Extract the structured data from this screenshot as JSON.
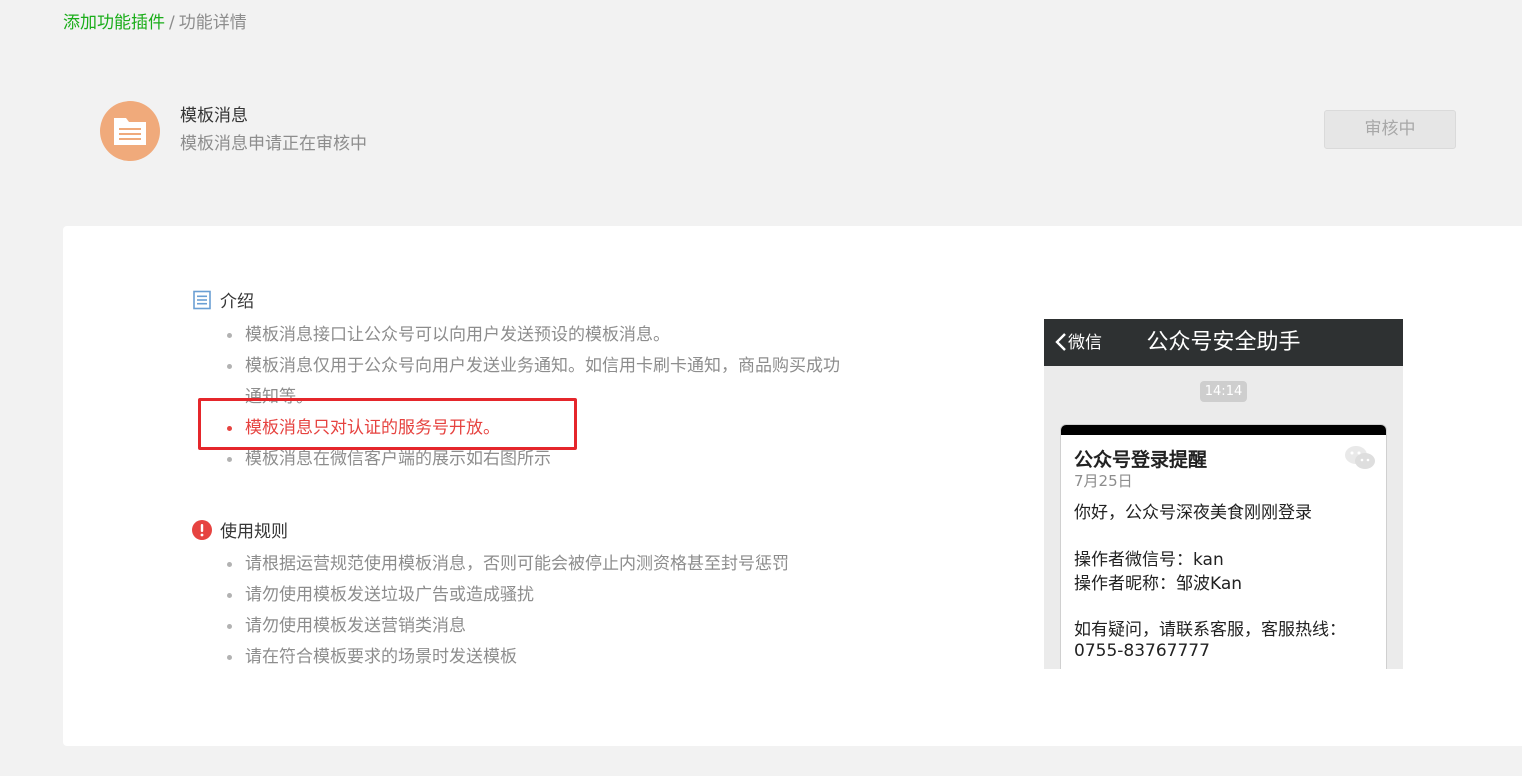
{
  "breadcrumb": {
    "parent": "添加功能插件",
    "separator": "/",
    "current": "功能详情"
  },
  "plugin": {
    "icon": "document-icon",
    "name": "模板消息",
    "status": "模板消息申请正在审核中",
    "button_label": "审核中",
    "icon_color": "#f0aa7b"
  },
  "intro": {
    "heading": "介绍",
    "items": [
      "模板消息接口让公众号可以向用户发送预设的模板消息。",
      "模板消息仅用于公众号向用户发送业务通知。如信用卡刷卡通知，商品购买成功通知等。",
      "模板消息只对认证的服务号开放。",
      "模板消息在微信客户端的展示如右图所示"
    ]
  },
  "rules": {
    "heading": "使用规则",
    "items": [
      "请根据运营规范使用模板消息，否则可能会被停止内测资格甚至封号惩罚",
      "请勿使用模板发送垃圾广告或造成骚扰",
      "请勿使用模板发送营销类消息",
      "请在符合模板要求的场景时发送模板"
    ]
  },
  "phone_preview": {
    "back_label": "微信",
    "title": "公众号安全助手",
    "time": "14:14",
    "message": {
      "title": "公众号登录提醒",
      "date": "7月25日",
      "greeting": "你好，公众号深夜美食刚刚登录",
      "operator_id": "操作者微信号：kan",
      "operator_nickname": "操作者昵称：邹波Kan",
      "contact": "如有疑问，请联系客服，客服热线：",
      "hotline": "0755-83767777"
    }
  },
  "colors": {
    "brand_green": "#1aad19",
    "warning_red": "#e64340",
    "highlight_red": "#e5262b"
  }
}
